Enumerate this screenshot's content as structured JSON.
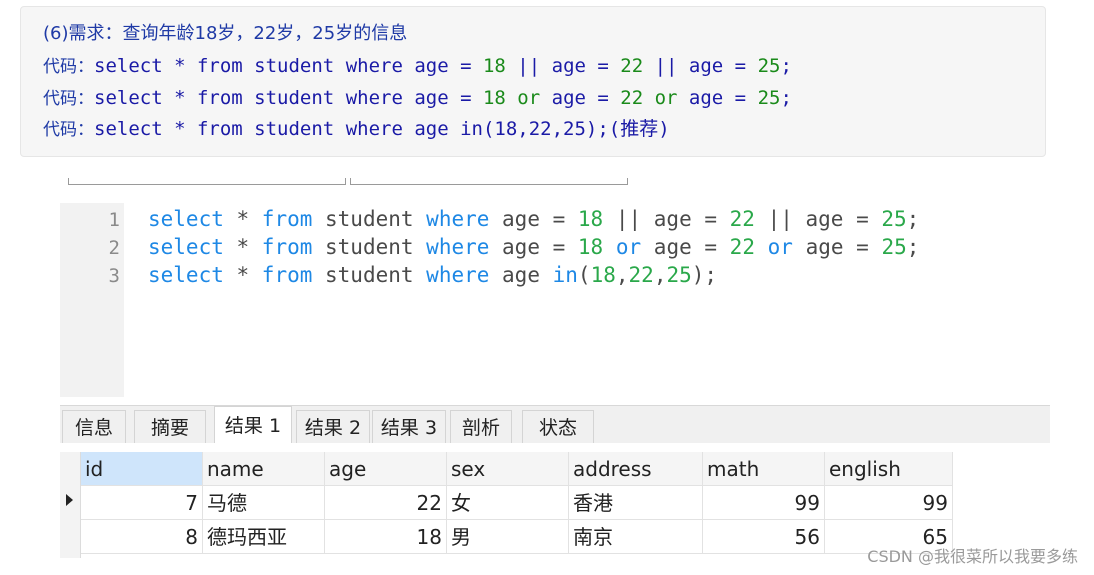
{
  "notes": {
    "title": "(6)需求：查询年龄18岁，22岁，25岁的信息",
    "lines": [
      {
        "prefix": "代码：",
        "parts": [
          {
            "t": "select ",
            "c": "kw"
          },
          {
            "t": "* ",
            "c": "kw"
          },
          {
            "t": "from ",
            "c": "kw"
          },
          {
            "t": "student ",
            "c": "kw"
          },
          {
            "t": "where ",
            "c": "kw"
          },
          {
            "t": "age = ",
            "c": "kw"
          },
          {
            "t": "18",
            "c": "num"
          },
          {
            "t": " || ",
            "c": "kw"
          },
          {
            "t": "age = ",
            "c": "kw"
          },
          {
            "t": "22",
            "c": "num"
          },
          {
            "t": " || ",
            "c": "kw"
          },
          {
            "t": "age = ",
            "c": "kw"
          },
          {
            "t": "25",
            "c": "num"
          },
          {
            "t": ";",
            "c": "kw"
          }
        ]
      },
      {
        "prefix": "代码：",
        "parts": [
          {
            "t": "select ",
            "c": "kw"
          },
          {
            "t": "* ",
            "c": "kw"
          },
          {
            "t": "from ",
            "c": "kw"
          },
          {
            "t": "student ",
            "c": "kw"
          },
          {
            "t": "where ",
            "c": "kw"
          },
          {
            "t": "age = ",
            "c": "kw"
          },
          {
            "t": "18",
            "c": "num"
          },
          {
            "t": " or ",
            "c": "num"
          },
          {
            "t": "age = ",
            "c": "kw"
          },
          {
            "t": "22",
            "c": "num"
          },
          {
            "t": " or ",
            "c": "num"
          },
          {
            "t": "age = ",
            "c": "kw"
          },
          {
            "t": "25",
            "c": "num"
          },
          {
            "t": ";",
            "c": "kw"
          }
        ]
      },
      {
        "prefix": "代码：",
        "parts": [
          {
            "t": "select ",
            "c": "kw"
          },
          {
            "t": "* ",
            "c": "kw"
          },
          {
            "t": "from ",
            "c": "kw"
          },
          {
            "t": "student ",
            "c": "kw"
          },
          {
            "t": "where ",
            "c": "kw"
          },
          {
            "t": "age in(18,22,25);(推荐)",
            "c": "kw"
          }
        ]
      }
    ]
  },
  "editor": {
    "lines": [
      {
        "num": "1",
        "parts": [
          {
            "t": "select",
            "c": "kw"
          },
          {
            "t": " * ",
            "c": "op"
          },
          {
            "t": "from",
            "c": "kw"
          },
          {
            "t": " student ",
            "c": "op"
          },
          {
            "t": "where",
            "c": "kw"
          },
          {
            "t": " age = ",
            "c": "op"
          },
          {
            "t": "18",
            "c": "num"
          },
          {
            "t": " || ",
            "c": "op"
          },
          {
            "t": "age = ",
            "c": "op"
          },
          {
            "t": "22",
            "c": "num"
          },
          {
            "t": " || ",
            "c": "op"
          },
          {
            "t": "age = ",
            "c": "op"
          },
          {
            "t": "25",
            "c": "num"
          },
          {
            "t": ";",
            "c": "op"
          }
        ]
      },
      {
        "num": "2",
        "parts": [
          {
            "t": "select",
            "c": "kw"
          },
          {
            "t": " * ",
            "c": "op"
          },
          {
            "t": "from",
            "c": "kw"
          },
          {
            "t": " student ",
            "c": "op"
          },
          {
            "t": "where",
            "c": "kw"
          },
          {
            "t": " age = ",
            "c": "op"
          },
          {
            "t": "18",
            "c": "num"
          },
          {
            "t": " ",
            "c": "op"
          },
          {
            "t": "or",
            "c": "kw"
          },
          {
            "t": " age = ",
            "c": "op"
          },
          {
            "t": "22",
            "c": "num"
          },
          {
            "t": " ",
            "c": "op"
          },
          {
            "t": "or",
            "c": "kw"
          },
          {
            "t": " age = ",
            "c": "op"
          },
          {
            "t": "25",
            "c": "num"
          },
          {
            "t": ";",
            "c": "op"
          }
        ]
      },
      {
        "num": "3",
        "parts": [
          {
            "t": "select",
            "c": "kw"
          },
          {
            "t": " * ",
            "c": "op"
          },
          {
            "t": "from",
            "c": "kw"
          },
          {
            "t": " student ",
            "c": "op"
          },
          {
            "t": "where",
            "c": "kw"
          },
          {
            "t": " age ",
            "c": "op"
          },
          {
            "t": "in",
            "c": "kw"
          },
          {
            "t": "(",
            "c": "op"
          },
          {
            "t": "18",
            "c": "num"
          },
          {
            "t": ",",
            "c": "op"
          },
          {
            "t": "22",
            "c": "num"
          },
          {
            "t": ",",
            "c": "op"
          },
          {
            "t": "25",
            "c": "num"
          },
          {
            "t": ");",
            "c": "op"
          }
        ]
      }
    ]
  },
  "tabs": [
    "信息",
    "摘要",
    "结果 1",
    "结果 2",
    "结果 3",
    "剖析",
    "状态"
  ],
  "active_tab": "结果 1",
  "table": {
    "columns": [
      "id",
      "name",
      "age",
      "sex",
      "address",
      "math",
      "english"
    ],
    "rows": [
      [
        "7",
        "马德",
        "22",
        "女",
        "香港",
        "99",
        "99"
      ],
      [
        "8",
        "德玛西亚",
        "18",
        "男",
        "南京",
        "56",
        "65"
      ]
    ]
  },
  "watermark": "CSDN @我很菜所以我要多练",
  "colors": {
    "keyword": "#1e88e5",
    "number": "#2aa84a",
    "note_keyword": "#1a1aa6",
    "note_number": "#1a8a1a"
  }
}
